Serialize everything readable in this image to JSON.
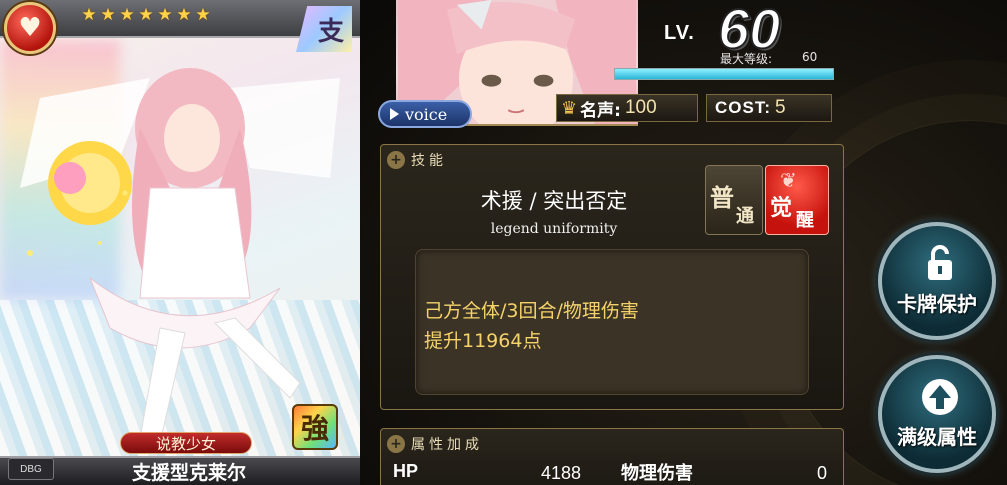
{
  "card": {
    "attribute_icon": "heart-emblem-icon",
    "stars": 7,
    "type_char": "支",
    "strong_char": "強",
    "subtitle": "说教少女",
    "name": "支援型克莱尔",
    "tag": "DBG"
  },
  "level": {
    "lv_label": "LV.",
    "value": "60",
    "max_label": "最大等级:",
    "max_value": "60",
    "exp_fraction": 1.0
  },
  "voice": {
    "label": "voice"
  },
  "stats": {
    "fame_label": "名声:",
    "fame_value": "100",
    "cost_label": "COST:",
    "cost_value": "5"
  },
  "skill": {
    "header": "技能",
    "name": "术援 / 突出否定",
    "subname": "legend uniformity",
    "normal_char1": "普",
    "normal_char2": "通",
    "awaken_char1": "觉",
    "awaken_char2": "醒",
    "desc_line1": "己方全体/3回合/物理伤害",
    "desc_line2": "提升11964点"
  },
  "attributes": {
    "header": "属性加成",
    "hp_label": "HP",
    "hp_value": "4188",
    "phys_label": "物理伤害",
    "phys_value": "0"
  },
  "buttons": {
    "protect_label": "卡牌保护",
    "maxattr_label": "满级属性"
  },
  "colors": {
    "gold_text": "#f6d36a",
    "awaken_red": "#c5120c",
    "panel_border": "#8a7546",
    "round_button": "#2f6d7e"
  }
}
